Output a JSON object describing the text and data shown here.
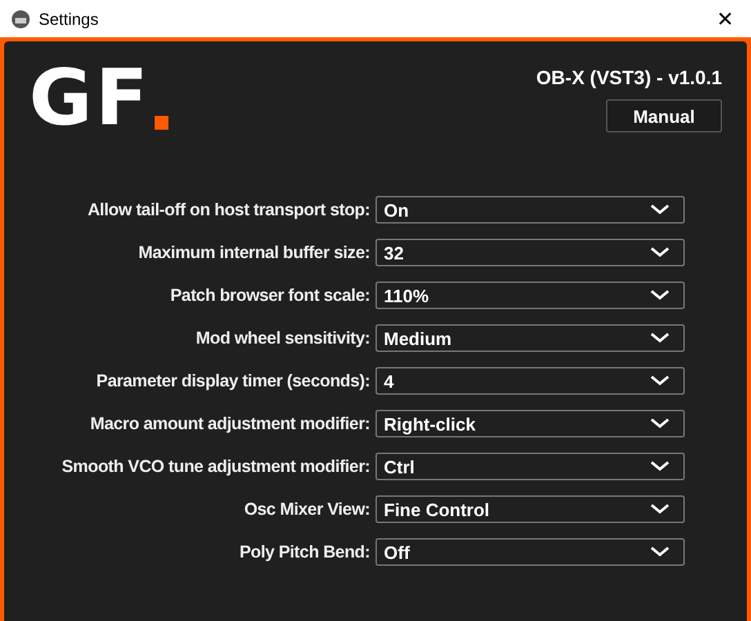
{
  "window": {
    "title": "Settings",
    "close": "✕"
  },
  "logo": {
    "text": "GF"
  },
  "version": "OB-X (VST3) - v1.0.1",
  "manual_button": "Manual",
  "settings": [
    {
      "label": "Allow tail-off on host transport stop:",
      "value": "On"
    },
    {
      "label": "Maximum internal buffer size:",
      "value": "32"
    },
    {
      "label": "Patch browser font scale:",
      "value": "110%"
    },
    {
      "label": "Mod wheel sensitivity:",
      "value": "Medium"
    },
    {
      "label": "Parameter display timer (seconds):",
      "value": "4"
    },
    {
      "label": "Macro amount adjustment modifier:",
      "value": "Right-click"
    },
    {
      "label": "Smooth VCO tune adjustment modifier:",
      "value": "Ctrl"
    },
    {
      "label": "Osc Mixer View:",
      "value": "Fine Control"
    },
    {
      "label": "Poly Pitch Bend:",
      "value": "Off"
    }
  ]
}
